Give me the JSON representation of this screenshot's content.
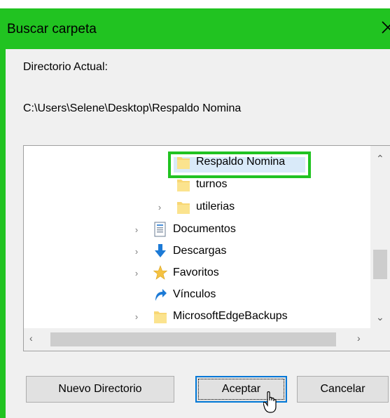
{
  "dialog": {
    "title": "Buscar carpeta",
    "accent_color": "#21c321"
  },
  "current_dir": {
    "label": "Directorio Actual:",
    "path": "C:\\Users\\Selene\\Desktop\\Respaldo Nomina"
  },
  "tree": {
    "items": [
      {
        "label": "Respaldo Nomina",
        "icon": "folder-icon",
        "selected": true,
        "expandable": false
      },
      {
        "label": "turnos",
        "icon": "folder-icon",
        "selected": false,
        "expandable": false
      },
      {
        "label": "utilerias",
        "icon": "folder-icon",
        "selected": false,
        "expandable": true
      },
      {
        "label": "Documentos",
        "icon": "documents-icon",
        "selected": false,
        "expandable": true
      },
      {
        "label": "Descargas",
        "icon": "downloads-icon",
        "selected": false,
        "expandable": true
      },
      {
        "label": "Favoritos",
        "icon": "favorites-star-icon",
        "selected": false,
        "expandable": true
      },
      {
        "label": "Vínculos",
        "icon": "links-icon",
        "selected": false,
        "expandable": false
      },
      {
        "label": "MicrosoftEdgeBackups",
        "icon": "folder-icon",
        "selected": false,
        "expandable": true
      }
    ]
  },
  "buttons": {
    "new_dir": "Nuevo Directorio",
    "accept": "Aceptar",
    "cancel": "Cancelar"
  }
}
